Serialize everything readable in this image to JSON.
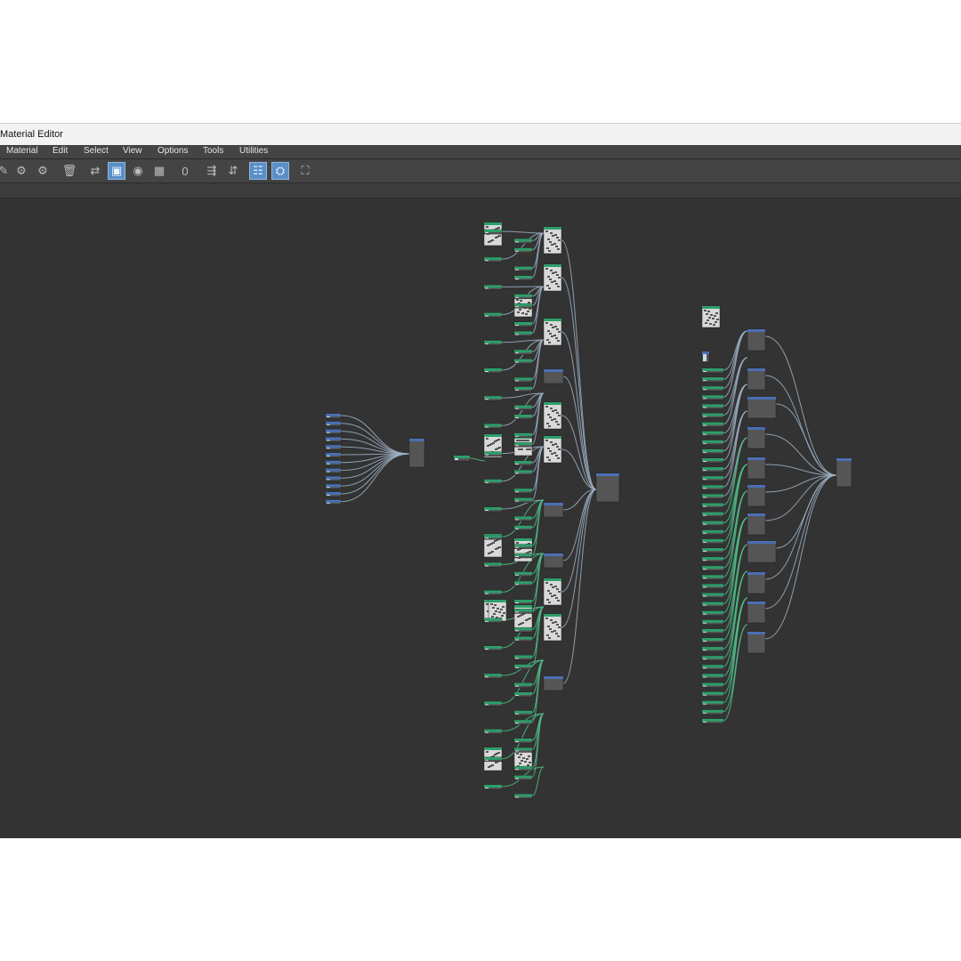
{
  "window": {
    "title": "Material Editor"
  },
  "menu": {
    "items": [
      "Material",
      "Edit",
      "Select",
      "View",
      "Options",
      "Tools",
      "Utilities"
    ]
  },
  "toolbar": {
    "tools": [
      {
        "icon": "eyedropper-icon",
        "glyph": "✎",
        "active": false
      },
      {
        "icon": "assign-material-icon",
        "glyph": "⚙",
        "active": false
      },
      {
        "icon": "put-to-scene-icon",
        "glyph": "⚙",
        "active": false
      },
      {
        "icon": "delete-icon",
        "glyph": "🗑",
        "active": false
      },
      {
        "icon": "move-children-icon",
        "glyph": "⇄",
        "active": false
      },
      {
        "icon": "show-map-in-viewport-icon",
        "glyph": "▣",
        "active": true
      },
      {
        "icon": "show-shaded-material-icon",
        "glyph": "◉",
        "active": false
      },
      {
        "icon": "checker-background-icon",
        "glyph": "▦",
        "active": false
      },
      {
        "icon": "material-id-icon",
        "glyph": "0",
        "active": false
      },
      {
        "icon": "layout-all-icon",
        "glyph": "⇶",
        "active": false
      },
      {
        "icon": "layout-children-icon",
        "glyph": "⇵",
        "active": false
      },
      {
        "icon": "parameter-editor-icon",
        "glyph": "☷",
        "active": true
      },
      {
        "icon": "material-map-browser-icon",
        "glyph": "⛭",
        "active": true
      },
      {
        "icon": "navigator-icon",
        "glyph": "⛶",
        "active": false
      }
    ]
  },
  "colors": {
    "canvas": "#333333",
    "node_header_blue": "#4a6fb3",
    "node_header_green": "#2e9e6a",
    "node_body": "#555555",
    "wire": "#9fb2c6",
    "wire_green": "#4fc28a"
  }
}
